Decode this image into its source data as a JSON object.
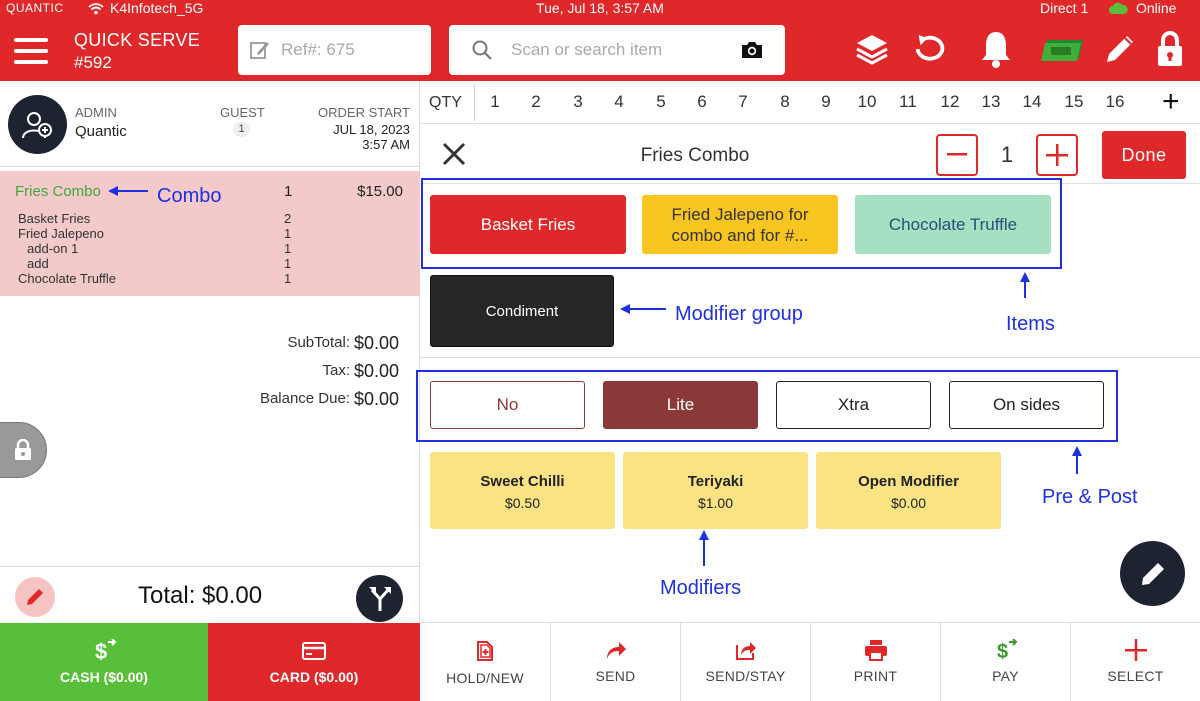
{
  "status": {
    "brand": "QUANTIC",
    "wifi_name": "K4Infotech_5G",
    "datetime": "Tue, Jul 18, 3:57 AM",
    "direct": "Direct 1",
    "online": "Online"
  },
  "header": {
    "mode": "QUICK SERVE",
    "order_number": "#592",
    "ref_placeholder": "Ref#: 675",
    "search_placeholder": "Scan or search item"
  },
  "order_info": {
    "role": "ADMIN",
    "user": "Quantic",
    "guest_label": "GUEST",
    "guest_count": "1",
    "order_start_label": "ORDER START",
    "order_start_date": "JUL 18, 2023",
    "order_start_time": "3:57 AM"
  },
  "cart": {
    "combo": {
      "name": "Fries Combo",
      "qty": "1",
      "price": "$15.00"
    },
    "subitems": [
      {
        "name": "Basket Fries",
        "qty": "2"
      },
      {
        "name": "Fried Jalepeno",
        "qty": "1"
      },
      {
        "name": "add-on 1",
        "qty": "1"
      },
      {
        "name": "add",
        "qty": "1"
      },
      {
        "name": "Chocolate Truffle",
        "qty": "1"
      }
    ]
  },
  "totals": {
    "subtotal_label": "SubTotal:",
    "subtotal": "$0.00",
    "tax_label": "Tax:",
    "tax": "$0.00",
    "balance_label": "Balance Due:",
    "balance": "$0.00",
    "total": "Total: $0.00"
  },
  "payment": {
    "cash": "CASH ($0.00)",
    "card": "CARD ($0.00)"
  },
  "qty_row": {
    "label": "QTY",
    "numbers": [
      "1",
      "2",
      "3",
      "4",
      "5",
      "6",
      "7",
      "8",
      "9",
      "10",
      "11",
      "12",
      "13",
      "14",
      "15",
      "16"
    ],
    "add_symbol": "+"
  },
  "editor": {
    "title": "Fries Combo",
    "quantity": "1",
    "done": "Done",
    "items": [
      {
        "label": "Basket Fries",
        "color": "#e0282a"
      },
      {
        "label": "Fried Jalepeno for combo and for #...",
        "color": "#f9c520"
      },
      {
        "label": "Chocolate Truffle",
        "color": "#a5e0c2"
      }
    ],
    "modifier_group": "Condiment",
    "pre_post": [
      {
        "label": "No",
        "selected": false
      },
      {
        "label": "Lite",
        "selected": true
      },
      {
        "label": "Xtra",
        "selected": false
      },
      {
        "label": "On sides",
        "selected": false
      }
    ],
    "modifiers": [
      {
        "name": "Sweet Chilli",
        "price": "$0.50"
      },
      {
        "name": "Teriyaki",
        "price": "$1.00"
      },
      {
        "name": "Open Modifier",
        "price": "$0.00"
      }
    ]
  },
  "annotations": {
    "combo": "Combo",
    "modifier_group": "Modifier group",
    "items": "Items",
    "pre_post": "Pre & Post",
    "modifiers": "Modifiers"
  },
  "bottom_actions": [
    "HOLD/NEW",
    "SEND",
    "SEND/STAY",
    "PRINT",
    "PAY",
    "SELECT"
  ],
  "icons": [
    "menu-icon",
    "wifi-icon",
    "cloud-icon",
    "edit-note-icon",
    "search-icon",
    "camera-icon",
    "layers-icon",
    "refresh-icon",
    "bell-icon",
    "cash-drawer-icon",
    "pencil-icon",
    "lock-icon",
    "add-user-icon",
    "split-icon",
    "dollar-icon",
    "card-icon",
    "close-icon",
    "minus-icon",
    "plus-icon",
    "hold-new-icon",
    "send-icon",
    "send-stay-icon",
    "print-icon",
    "pay-icon",
    "select-plus-icon"
  ],
  "colors": {
    "brand_red": "#e0282a",
    "cash_green": "#59bf3a",
    "annotation_blue": "#1f30e0",
    "combo_green": "#3fa83d",
    "selected_pre": "#8a3838",
    "modifier_yellow": "#fbe384"
  }
}
